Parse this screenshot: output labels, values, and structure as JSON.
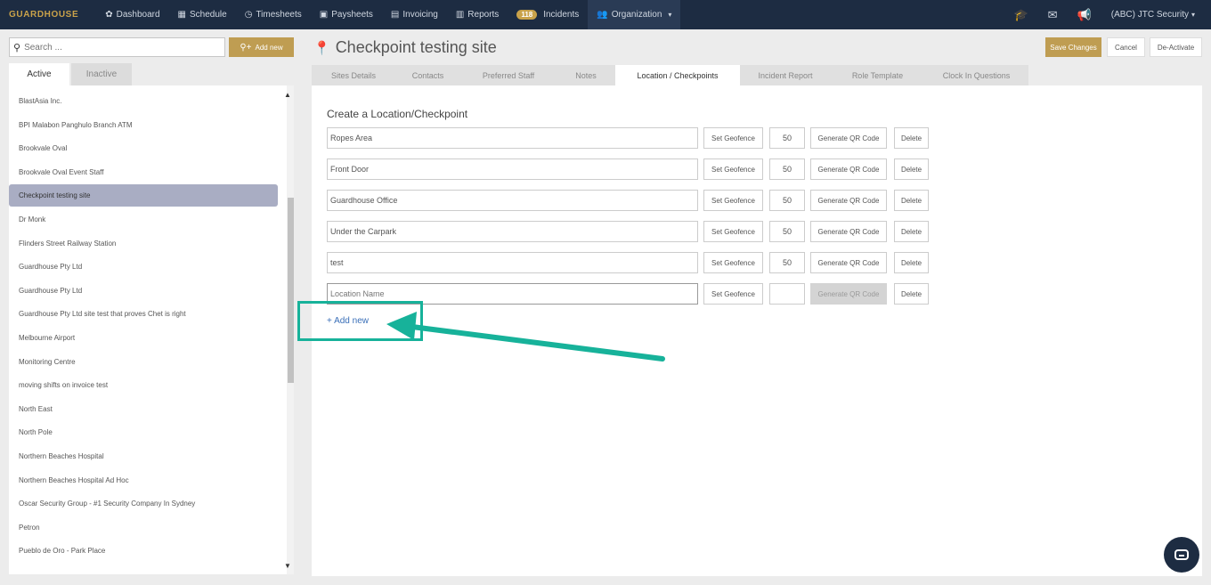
{
  "nav": {
    "brand": "GUARDHOUSE",
    "items": [
      {
        "label": "Dashboard",
        "icon": "palette-icon"
      },
      {
        "label": "Schedule",
        "icon": "calendar-icon"
      },
      {
        "label": "Timesheets",
        "icon": "clock-icon"
      },
      {
        "label": "Paysheets",
        "icon": "money-icon"
      },
      {
        "label": "Invoicing",
        "icon": "invoice-icon"
      },
      {
        "label": "Reports",
        "icon": "table-icon"
      },
      {
        "label": "Incidents",
        "badge": "118"
      },
      {
        "label": "Organization",
        "icon": "users-icon"
      }
    ],
    "org_label": "(ABC) JTC Security"
  },
  "left": {
    "search_placeholder": "Search ...",
    "add_label": "Add new",
    "tabs": [
      "Active",
      "Inactive"
    ],
    "items": [
      "BlastAsia Inc.",
      "BPI Malabon Panghulo Branch ATM",
      "Brookvale Oval",
      "Brookvale Oval Event Staff",
      "Checkpoint testing site",
      "Dr Monk",
      "Flinders Street Railway Station",
      "Guardhouse Pty Ltd",
      "Guardhouse Pty Ltd",
      "Guardhouse Pty Ltd site test that proves Chet is right",
      "Melbourne Airport",
      "Monitoring Centre",
      "moving shifts on invoice test",
      "North East",
      "North Pole",
      "Northern Beaches Hospital",
      "Northern Beaches Hospital Ad Hoc",
      "Oscar Security Group - #1 Security Company In Sydney",
      "Petron",
      "Pueblo de Oro - Park Place"
    ],
    "selected_index": 4
  },
  "header": {
    "title": "Checkpoint testing site",
    "save": "Save Changes",
    "cancel": "Cancel",
    "deactivate": "De-Activate"
  },
  "tabs": [
    "Sites Details",
    "Contacts",
    "Preferred Staff",
    "Notes",
    "Location / Checkpoints",
    "Incident Report",
    "Role Template",
    "Clock In Questions"
  ],
  "active_tab": "Location / Checkpoints",
  "main": {
    "section_title": "Create a Location/Checkpoint",
    "set_geofence": "Set Geofence",
    "generate_qr": "Generate QR Code",
    "delete": "Delete",
    "location_placeholder": "Location Name",
    "checkpoints": [
      {
        "name": "Ropes Area",
        "radius": "50"
      },
      {
        "name": "Front Door",
        "radius": "50"
      },
      {
        "name": "Guardhouse Office",
        "radius": "50"
      },
      {
        "name": "Under the Carpark",
        "radius": "50"
      },
      {
        "name": "test",
        "radius": "50"
      }
    ],
    "add_new": "+ Add new"
  },
  "colors": {
    "nav_bg": "#1d2c42",
    "accent_gold": "#bf9d52",
    "annotation_teal": "#17b29a",
    "link_blue": "#3a6fb8"
  }
}
